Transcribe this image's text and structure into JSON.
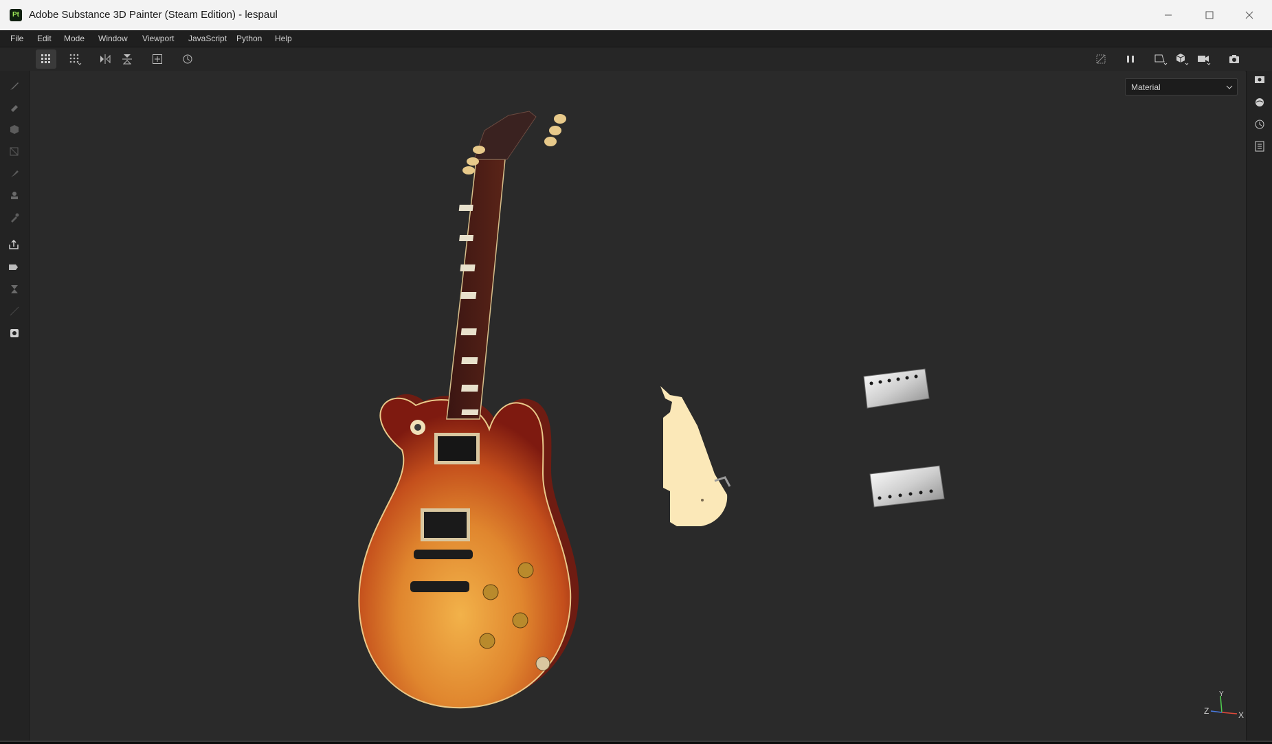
{
  "window": {
    "title": "Adobe Substance 3D Painter (Steam Edition) - lespaul",
    "app_icon_text": "Pt",
    "controls": {
      "minimize_icon": "minimize-icon",
      "maximize_icon": "maximize-icon",
      "close_icon": "close-icon"
    }
  },
  "menu": {
    "items": [
      "File",
      "Edit",
      "Mode",
      "Window",
      "Viewport",
      "JavaScript",
      "Python",
      "Help"
    ]
  },
  "toolbar": {
    "left_icons": [
      "grid-view-icon",
      "grid-options-icon",
      "mirror-x-icon",
      "mirror-y-icon",
      "add-frame-icon",
      "history-icon"
    ],
    "right_icons": [
      "hide-icon",
      "pause-icon",
      "perspective-icon",
      "cube-icon",
      "camera-icon",
      "screenshot-icon"
    ]
  },
  "left_tools": [
    "paint-brush-icon",
    "eraser-icon",
    "projection-icon",
    "polygon-fill-icon",
    "smudge-icon",
    "clone-stamp-icon",
    "color-picker-icon",
    "export-icon",
    "bake-icon",
    "hourglass-icon",
    "measure-icon",
    "material-ball-icon"
  ],
  "right_tools": [
    "display-settings-icon",
    "environment-icon",
    "history-icon",
    "log-icon"
  ],
  "viewport": {
    "mode_dropdown": {
      "selected": "Material"
    },
    "axis_labels": {
      "x": "X",
      "y": "Y",
      "z": "Z"
    }
  },
  "colors": {
    "viewport_bg": "#2a2a2a",
    "panel_bg": "#232323",
    "guitar_burst_center": "#f0a040",
    "guitar_burst_edge": "#8a1e10",
    "pickguard": "#fbe8b8",
    "chrome": "#d8d8d8"
  }
}
